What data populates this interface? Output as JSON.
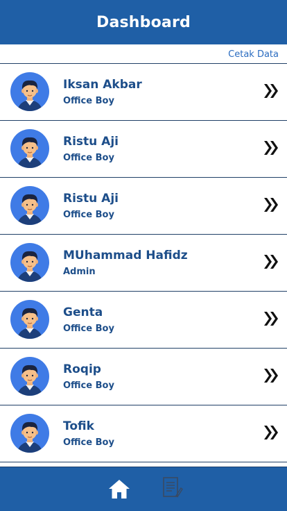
{
  "header": {
    "title": "Dashboard"
  },
  "actions": {
    "print_label": "Cetak Data"
  },
  "employees": [
    {
      "name": "Iksan Akbar",
      "role": "Office Boy"
    },
    {
      "name": "Ristu Aji",
      "role": "Office Boy"
    },
    {
      "name": "Ristu Aji",
      "role": "Office Boy"
    },
    {
      "name": "MUhammad Hafidz",
      "role": "Admin"
    },
    {
      "name": "Genta",
      "role": "Office Boy"
    },
    {
      "name": "Roqip",
      "role": "Office Boy"
    },
    {
      "name": "Tofik",
      "role": "Office Boy"
    }
  ],
  "icons": {
    "avatar": "user-avatar-icon",
    "row_action": "double-chevron-right-icon",
    "nav_home": "home-icon",
    "nav_report": "document-icon"
  },
  "colors": {
    "primary": "#1f5fa6",
    "text": "#1d4e8a",
    "link": "#2a6cc0",
    "avatar_bg": "#3f7be6"
  }
}
